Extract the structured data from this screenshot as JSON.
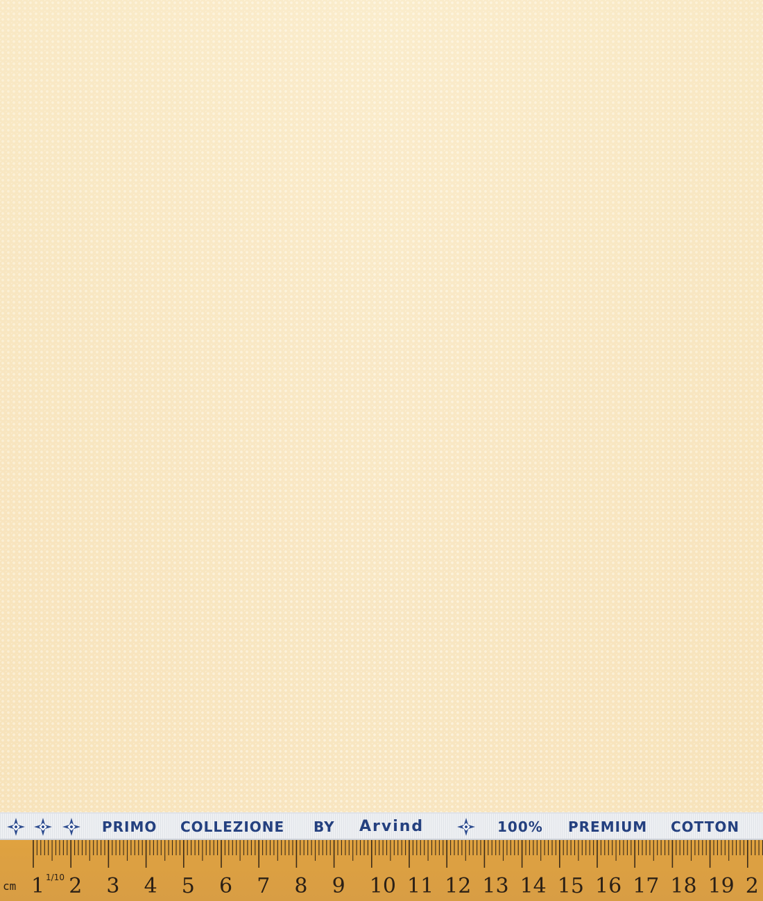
{
  "selvedge": {
    "brand_line": [
      "PRIMO",
      "COLLEZIONE",
      "BY"
    ],
    "brand_logo": "Arvind",
    "fabric_line": [
      "100%",
      "PREMIUM",
      "COTTON"
    ],
    "icon": "diamond-star-icon",
    "text_color": "#24407f",
    "background_color": "#eef0f3"
  },
  "fabric": {
    "base_color": "#f9e6c0",
    "pattern": "small dot weave"
  },
  "ruler": {
    "unit_label": "cm",
    "fraction_label": "1/10",
    "labels": [
      "1",
      "2",
      "3",
      "4",
      "5",
      "6",
      "7",
      "8",
      "9",
      "10",
      "11",
      "12",
      "13",
      "14",
      "15",
      "16",
      "17",
      "18",
      "19",
      "2"
    ],
    "color": "#dfa241"
  }
}
